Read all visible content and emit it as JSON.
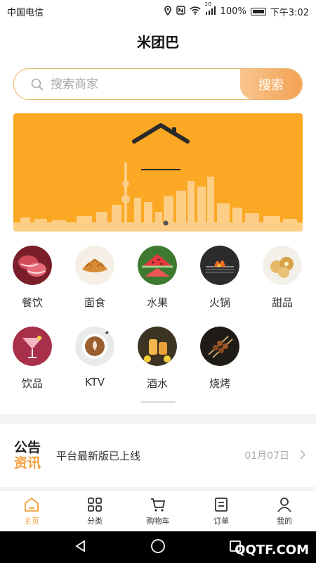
{
  "status_bar": {
    "carrier": "中国电信",
    "network": "2G",
    "battery": "100%",
    "time": "下午3:02"
  },
  "header": {
    "title": "米团巴"
  },
  "search": {
    "placeholder": "搜索商家",
    "button_label": "搜索"
  },
  "categories": [
    {
      "label": "餐饮",
      "icon": "meat-icon"
    },
    {
      "label": "面食",
      "icon": "bread-icon"
    },
    {
      "label": "水果",
      "icon": "watermelon-icon"
    },
    {
      "label": "火锅",
      "icon": "hotpot-icon"
    },
    {
      "label": "甜品",
      "icon": "dessert-icon"
    },
    {
      "label": "饮品",
      "icon": "cocktail-icon"
    },
    {
      "label": "KTV",
      "icon": "coffee-icon"
    },
    {
      "label": "酒水",
      "icon": "wine-icon"
    },
    {
      "label": "烧烤",
      "icon": "barbecue-icon"
    }
  ],
  "notice": {
    "logo_line1": "公告",
    "logo_line2": "资讯",
    "text": "平台最新版已上线",
    "date": "01月07日"
  },
  "tabbar": [
    {
      "label": "主页",
      "icon": "home-icon",
      "active": true
    },
    {
      "label": "分类",
      "icon": "grid-icon",
      "active": false
    },
    {
      "label": "购物车",
      "icon": "cart-icon",
      "active": false
    },
    {
      "label": "订单",
      "icon": "order-icon",
      "active": false
    },
    {
      "label": "我的",
      "icon": "user-icon",
      "active": false
    }
  ],
  "watermark": "QQTF.COM",
  "colors": {
    "accent": "#f3a03a",
    "banner": "#fba824"
  }
}
